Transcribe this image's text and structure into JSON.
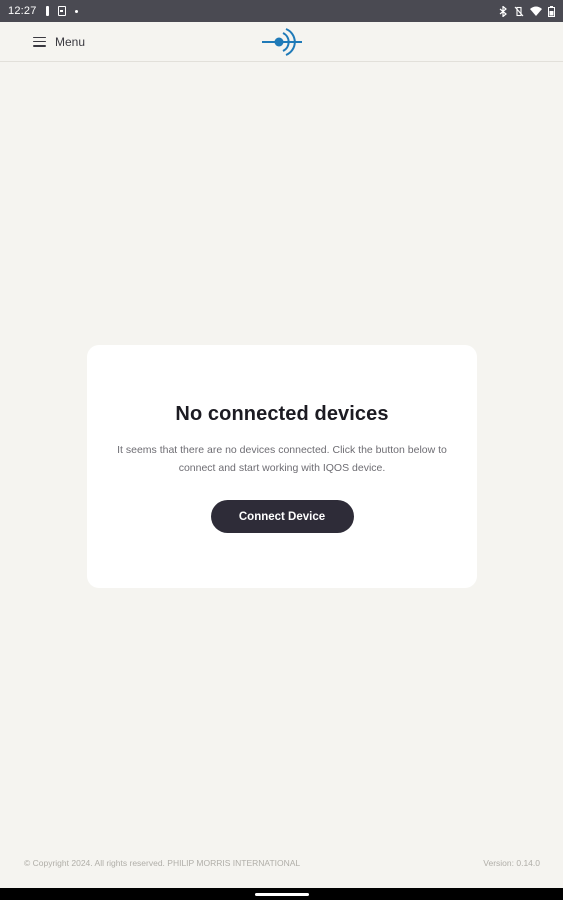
{
  "status_bar": {
    "time": "12:27"
  },
  "header": {
    "menu_label": "Menu",
    "logo_color": "#1f7ab8"
  },
  "card": {
    "title": "No connected devices",
    "description": "It seems that there are no devices connected. Click the button below to connect and start working with IQOS device.",
    "button_label": "Connect Device"
  },
  "footer": {
    "copyright": "© Copyright 2024. All rights reserved. PHILIP MORRIS INTERNATIONAL",
    "version": "Version: 0.14.0"
  },
  "colors": {
    "background": "#f5f4f0",
    "card": "#ffffff",
    "button": "#2e2c38",
    "status_bar": "#4a4a52"
  }
}
